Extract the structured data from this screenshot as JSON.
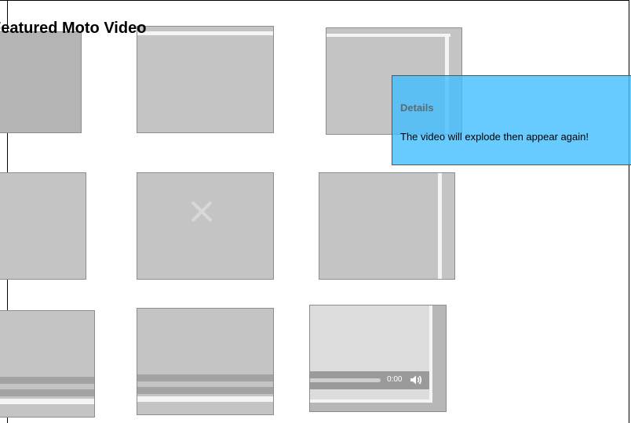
{
  "page": {
    "title": "Featured Moto Video"
  },
  "video": {
    "time": "0:00",
    "volume_icon": "speaker-icon"
  },
  "details": {
    "heading": "Details",
    "text": "The video will explode then appear again!"
  },
  "colors": {
    "tile": "#c4c4c4",
    "tile_border": "#8d8d8d",
    "stripe_white": "#f4f4f4",
    "stripe_grey": "#a3a3a3",
    "panel": "#66cbff"
  },
  "icons": [
    "close-x-icon",
    "speaker-icon"
  ]
}
